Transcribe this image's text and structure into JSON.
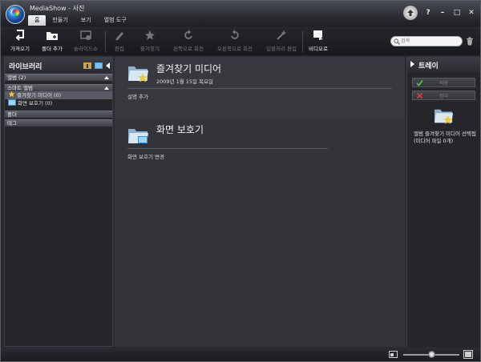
{
  "window": {
    "title": "MediaShow  - 사진"
  },
  "menu": [
    {
      "label": "홈",
      "active": true
    },
    {
      "label": "만들기"
    },
    {
      "label": "보기"
    },
    {
      "label": "앨범 도구"
    }
  ],
  "window_buttons": {
    "help": "?",
    "minimize": "–",
    "maximize": "□",
    "close": "✕"
  },
  "toolbar": {
    "import": "가져오기",
    "add_folder": "폴더 추가",
    "slideshow": "슬라이드쇼",
    "edit": "편집",
    "favorites": "즐겨찾기",
    "rotate_left": "왼쪽으로 회전",
    "rotate_right": "오른쪽으로 회전",
    "batch_edit": "일괄처리 편집",
    "to_video": "비디오로"
  },
  "search": {
    "placeholder": "검색",
    "value": ""
  },
  "library": {
    "title": "라이브러리",
    "albums": "앨범 (2)",
    "smart_albums": "스마트 앨범",
    "smart_items": [
      {
        "label": "즐겨찾기 미디어 (0)",
        "selected": true
      },
      {
        "label": "화면 보호기 (0)",
        "selected": false
      }
    ],
    "folders": "폴더",
    "tags": "태그"
  },
  "main": {
    "albums": [
      {
        "title": "즐겨찾기 미디어",
        "date": "2009년 1월 15일 목요일",
        "desc": "설명 추가"
      },
      {
        "title": "화면 보호기",
        "date": "",
        "desc": "화면 보호기 변경"
      }
    ]
  },
  "tray": {
    "title": "트레이",
    "apply": "적용",
    "clear": "정리",
    "info": "앨범 즐겨찾기 미디어 선택됨(미디어 파일 0개)"
  },
  "colors": {
    "accent": "#e8c040",
    "background": "#2a2b30",
    "panel": "#25262a"
  }
}
